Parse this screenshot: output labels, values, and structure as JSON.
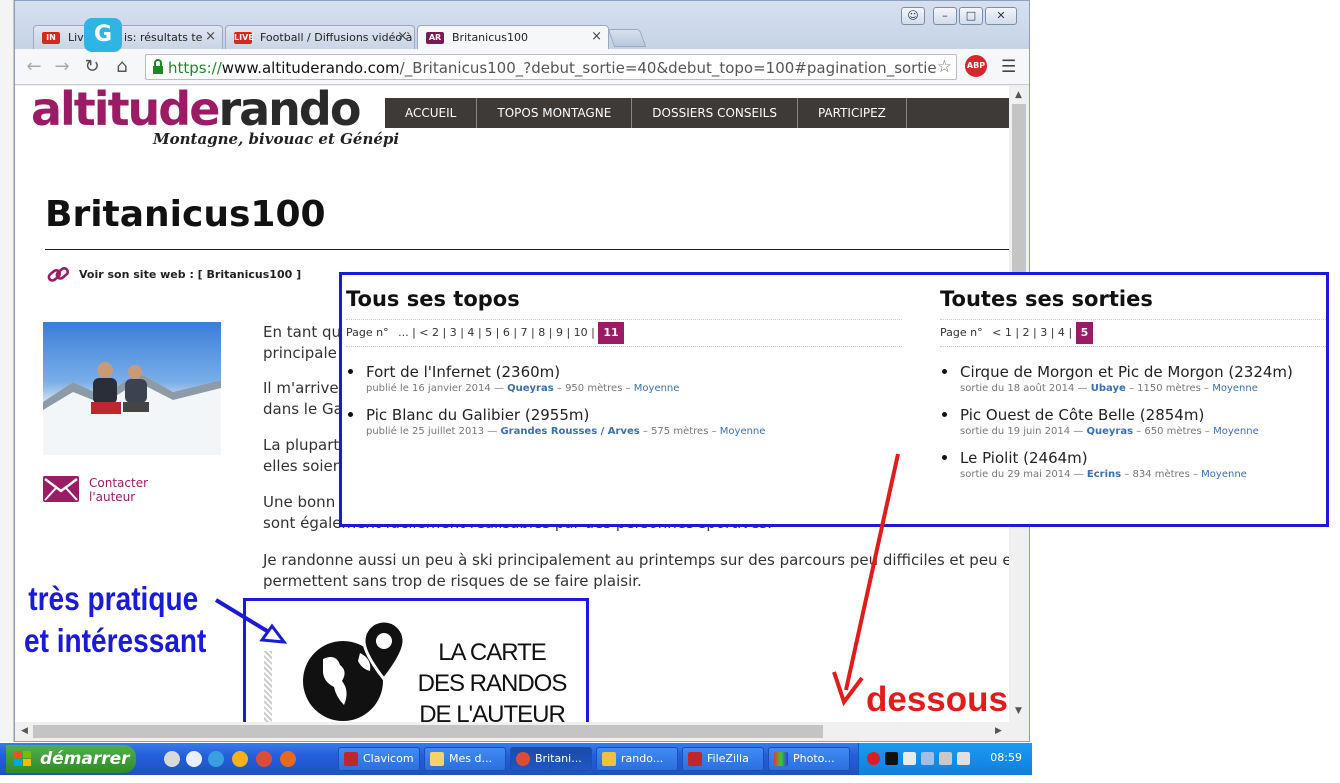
{
  "browser": {
    "tabs": [
      {
        "label": "Live",
        "favicon": "IN"
      },
      {
        "label": "is: résultats te",
        "favicon": ""
      },
      {
        "label": "Football / Diffusions vidéo à",
        "favicon": "LIVE"
      },
      {
        "label": "Britanicus100",
        "favicon": "AR"
      }
    ],
    "url": {
      "scheme": "https://",
      "host": "www.altituderando.com",
      "path": "/_Britanicus100_?debut_sortie=40&debut_topo=100#pagination_sortie"
    },
    "abp": "ABP",
    "grammarly": "G"
  },
  "site": {
    "logo_a": "altitude",
    "logo_b": "rando",
    "tagline": "Montagne, bivouac et Génépi",
    "nav": [
      "ACCUEIL",
      "TOPOS MONTAGNE",
      "DOSSIERS CONSEILS",
      "PARTICIPEZ"
    ]
  },
  "profile": {
    "title": "Britanicus100",
    "website_label": "Voir son site web : [ Britanicus100 ]",
    "contact_label": "Contacter l'auteur",
    "paragraphs": [
      "En tant qu",
      "principale",
      "Il m'arrive",
      "dans le Ga",
      "La plupart",
      "elles soien",
      "Une bonn",
      "sont également facilement réalisables par des personnes sportives.",
      "Je randonne aussi un peu à ski principalement au printemps sur des parcours peu difficiles et peu e",
      "permettent sans trop de risques de se faire plaisir."
    ],
    "carte_lines": [
      "LA CARTE",
      "DES RANDOS",
      "DE L'AUTEUR"
    ]
  },
  "topos": {
    "heading": "Tous ses topos",
    "pager_label": "Page n°",
    "pager": [
      "...",
      "| < 2",
      "| 3",
      "| 4",
      "| 5",
      "| 6",
      "| 7",
      "| 8",
      "| 9",
      "| 10",
      "|"
    ],
    "pager_current": "11",
    "items": [
      {
        "title": "Fort de l'Infernet (2360m)",
        "prefix": "publié le 16 janvier 2014 —",
        "region": "Queyras",
        "detail": "– 950 mètres –",
        "level": "Moyenne"
      },
      {
        "title": "Pic Blanc du Galibier (2955m)",
        "prefix": "publié le 25 juillet 2013 —",
        "region": "Grandes Rousses / Arves",
        "detail": "– 575 mètres –",
        "level": "Moyenne"
      }
    ]
  },
  "sorties": {
    "heading": "Toutes ses sorties",
    "pager_label": "Page n°",
    "pager": [
      "< 1",
      "| 2",
      "| 3",
      "| 4",
      "|"
    ],
    "pager_current": "5",
    "items": [
      {
        "title": "Cirque de Morgon et Pic de Morgon (2324m)",
        "prefix": "sortie du 18 août 2014 —",
        "region": "Ubaye",
        "detail": "– 1150 mètres –",
        "level": "Moyenne"
      },
      {
        "title": "Pic Ouest de Côte Belle (2854m)",
        "prefix": "sortie du 19 juin 2014 —",
        "region": "Queyras",
        "detail": "– 650 mètres –",
        "level": "Moyenne"
      },
      {
        "title": "Le Piolit (2464m)",
        "prefix": "sortie du 29 mai 2014 —",
        "region": "Ecrins",
        "detail": "– 834 mètres –",
        "level": "Moyenne"
      }
    ]
  },
  "annotations": {
    "blue_line1": "très pratique",
    "blue_line2": "et intéressant",
    "red": "dessous"
  },
  "taskbar": {
    "start": "démarrer",
    "buttons": [
      "Clavicom",
      "Mes d...",
      "Britani...",
      "rando...",
      "FileZilla",
      "Photo..."
    ],
    "clock": "08:59"
  },
  "colors": {
    "accent": "#9b1c64",
    "annotation_blue": "#1a1adb",
    "annotation_red": "#e41b1b",
    "link_blue": "#3a6fb0"
  }
}
